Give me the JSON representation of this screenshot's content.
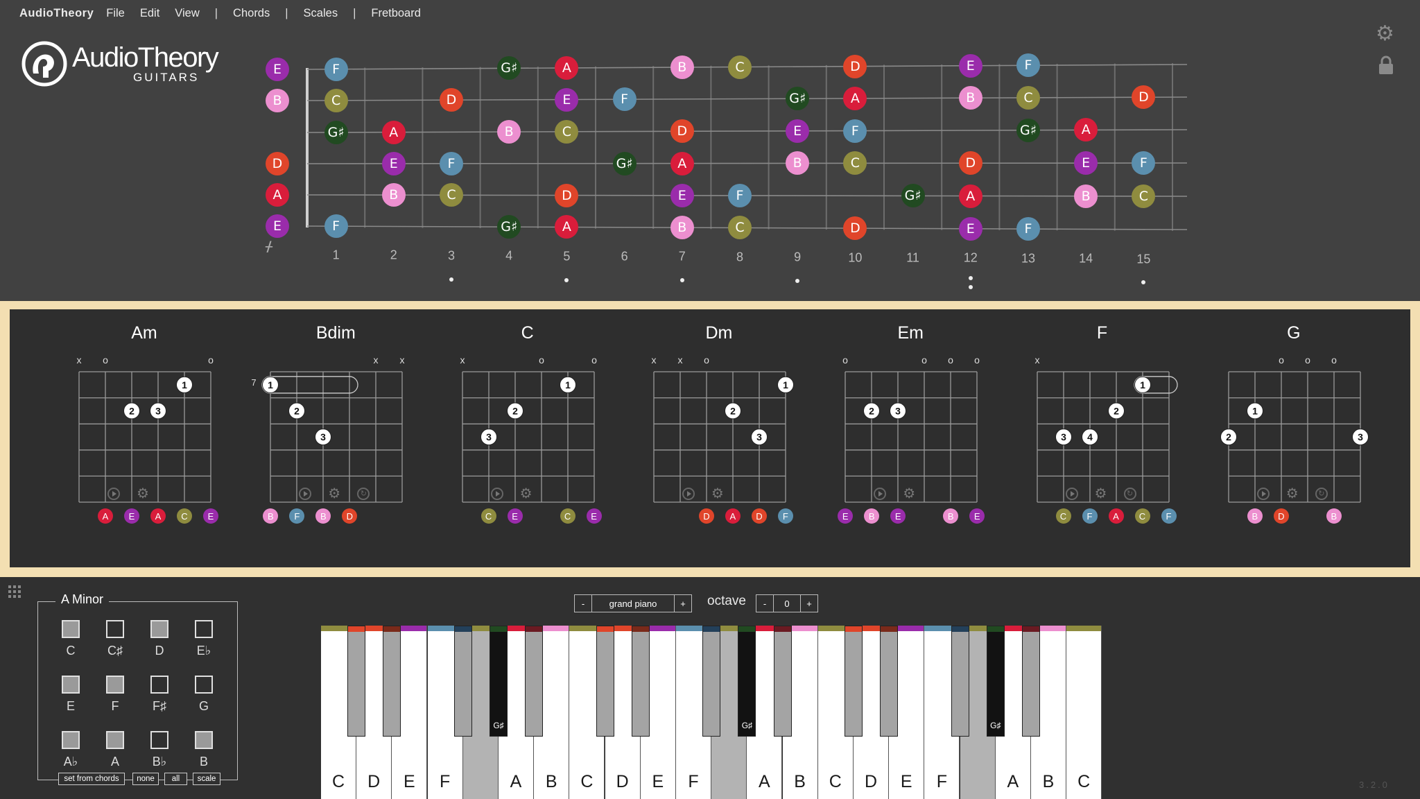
{
  "menubar": {
    "app_name": "AudioTheory",
    "items": [
      "File",
      "Edit",
      "View",
      "Chords",
      "Scales",
      "Fretboard"
    ],
    "separator": "|"
  },
  "logo": {
    "word": "AudioTheory",
    "sub": "GUITARS"
  },
  "icons": {
    "settings": "gear-icon",
    "lock": "lock-icon",
    "nut": "fork-icon",
    "grid": "grid-icon"
  },
  "note_colors": {
    "C": "#8f8c3f",
    "C#": "#1e3a1e",
    "D": "#e0452a",
    "D#": "#7a2a1a",
    "E": "#9a2cab",
    "F": "#5b8fae",
    "F#": "#23405a",
    "G": "#2f5b2f",
    "G#": "#214a21",
    "A": "#d91d3b",
    "A#": "#6a1a22",
    "B": "#ec8fcf"
  },
  "fretboard": {
    "open_notes": [
      "E",
      "B",
      "",
      "D",
      "A",
      "E"
    ],
    "fret_numbers": [
      "1",
      "2",
      "3",
      "4",
      "5",
      "6",
      "7",
      "8",
      "9",
      "10",
      "11",
      "12",
      "13",
      "14",
      "15"
    ],
    "inlay_frets": [
      3,
      5,
      7,
      9,
      15
    ],
    "double_inlay_fret": 12,
    "notes": [
      [
        "F",
        "",
        "",
        "G♯",
        "A",
        "",
        "B",
        "C",
        "",
        "D",
        "",
        "E",
        "F",
        "",
        ""
      ],
      [
        "C",
        "",
        "D",
        "",
        "E",
        "F",
        "",
        "",
        "G♯",
        "A",
        "",
        "B",
        "C",
        "",
        "D"
      ],
      [
        "G♯",
        "A",
        "",
        "B",
        "C",
        "",
        "D",
        "",
        "E",
        "F",
        "",
        "",
        "G♯",
        "A",
        ""
      ],
      [
        "",
        "E",
        "F",
        "",
        "",
        "G♯",
        "A",
        "",
        "B",
        "C",
        "",
        "D",
        "",
        "E",
        "F"
      ],
      [
        "",
        "B",
        "C",
        "",
        "D",
        "",
        "E",
        "F",
        "",
        "",
        "G♯",
        "A",
        "",
        "B",
        "C"
      ],
      [
        "F",
        "",
        "",
        "G♯",
        "A",
        "",
        "B",
        "C",
        "",
        "D",
        "",
        "E",
        "F",
        "",
        ""
      ]
    ]
  },
  "chords": [
    {
      "name": "Am",
      "markers": [
        "x",
        "o",
        "",
        "",
        "",
        "o"
      ],
      "fret_label": "",
      "dots": [
        {
          "s": 4,
          "f": 1,
          "n": "1"
        },
        {
          "s": 2,
          "f": 2,
          "n": "2"
        },
        {
          "s": 3,
          "f": 2,
          "n": "3"
        }
      ],
      "barre": null,
      "notes": [
        "",
        "A",
        "E",
        "A",
        "C",
        "E"
      ],
      "controls": [
        "play-icon",
        "gear-icon"
      ]
    },
    {
      "name": "Bdim",
      "markers": [
        "",
        "",
        "",
        "",
        "x",
        "x"
      ],
      "fret_label": "7",
      "dots": [
        {
          "s": 0,
          "f": 1,
          "n": "1"
        },
        {
          "s": 1,
          "f": 2,
          "n": "2"
        },
        {
          "s": 2,
          "f": 3,
          "n": "3"
        }
      ],
      "barre": {
        "from": 0,
        "to": 3,
        "f": 1
      },
      "notes": [
        "B",
        "F",
        "B",
        "D",
        "",
        ""
      ],
      "controls": [
        "play-icon",
        "gear-icon",
        "swap-icon"
      ]
    },
    {
      "name": "C",
      "markers": [
        "x",
        "",
        "",
        "o",
        "",
        "o"
      ],
      "fret_label": "",
      "dots": [
        {
          "s": 4,
          "f": 1,
          "n": "1"
        },
        {
          "s": 2,
          "f": 2,
          "n": "2"
        },
        {
          "s": 1,
          "f": 3,
          "n": "3"
        }
      ],
      "barre": null,
      "notes": [
        "",
        "C",
        "E",
        "",
        "C",
        "E"
      ],
      "controls": [
        "play-icon",
        "gear-icon"
      ]
    },
    {
      "name": "Dm",
      "markers": [
        "x",
        "x",
        "o",
        "",
        "",
        ""
      ],
      "fret_label": "",
      "dots": [
        {
          "s": 5,
          "f": 1,
          "n": "1"
        },
        {
          "s": 3,
          "f": 2,
          "n": "2"
        },
        {
          "s": 4,
          "f": 3,
          "n": "3"
        }
      ],
      "barre": null,
      "notes": [
        "",
        "",
        "D",
        "A",
        "D",
        "F"
      ],
      "controls": [
        "play-icon",
        "gear-icon"
      ]
    },
    {
      "name": "Em",
      "markers": [
        "o",
        "",
        "",
        "o",
        "o",
        "o"
      ],
      "fret_label": "",
      "dots": [
        {
          "s": 1,
          "f": 2,
          "n": "2"
        },
        {
          "s": 2,
          "f": 2,
          "n": "3"
        }
      ],
      "barre": null,
      "notes": [
        "E",
        "B",
        "E",
        "",
        "B",
        "E"
      ],
      "controls": [
        "play-icon",
        "gear-icon"
      ]
    },
    {
      "name": "F",
      "markers": [
        "x",
        "",
        "",
        "",
        "",
        ""
      ],
      "fret_label": "",
      "dots": [
        {
          "s": 4,
          "f": 1,
          "n": "1"
        },
        {
          "s": 3,
          "f": 2,
          "n": "2"
        },
        {
          "s": 1,
          "f": 3,
          "n": "3"
        },
        {
          "s": 2,
          "f": 3,
          "n": "4"
        }
      ],
      "barre": {
        "from": 4,
        "to": 5,
        "f": 1
      },
      "notes": [
        "",
        "C",
        "F",
        "A",
        "C",
        "F"
      ],
      "controls": [
        "play-icon",
        "gear-icon",
        "swap-icon"
      ]
    },
    {
      "name": "G",
      "markers": [
        "",
        "",
        "o",
        "o",
        "o",
        ""
      ],
      "fret_label": "",
      "dots": [
        {
          "s": 1,
          "f": 2,
          "n": "1"
        },
        {
          "s": 0,
          "f": 3,
          "n": "2"
        },
        {
          "s": 5,
          "f": 3,
          "n": "3"
        }
      ],
      "barre": null,
      "notes": [
        "",
        "B",
        "D",
        "",
        "B",
        ""
      ],
      "controls": [
        "play-icon",
        "gear-icon",
        "swap-icon"
      ]
    }
  ],
  "scale": {
    "title": "A Minor",
    "notes": [
      {
        "label": "C",
        "on": true
      },
      {
        "label": "C♯",
        "on": false
      },
      {
        "label": "D",
        "on": true
      },
      {
        "label": "E♭",
        "on": false
      },
      {
        "label": "E",
        "on": true
      },
      {
        "label": "F",
        "on": true
      },
      {
        "label": "F♯",
        "on": false
      },
      {
        "label": "G",
        "on": false
      },
      {
        "label": "A♭",
        "on": true
      },
      {
        "label": "A",
        "on": true
      },
      {
        "label": "B♭",
        "on": false
      },
      {
        "label": "B",
        "on": true
      }
    ],
    "buttons": [
      "set from chords",
      "none",
      "all",
      "scale"
    ]
  },
  "instrument": {
    "minus": "-",
    "plus": "+",
    "name": "grand piano"
  },
  "octave": {
    "label": "octave",
    "minus": "-",
    "value": "0",
    "plus": "+"
  },
  "piano": {
    "white_keys": [
      {
        "n": "C",
        "top": "C",
        "sh": false
      },
      {
        "n": "D",
        "top": "D",
        "sh": false
      },
      {
        "n": "E",
        "top": "E",
        "sh": false
      },
      {
        "n": "F",
        "top": "F",
        "sh": false
      },
      {
        "n": "",
        "top": "",
        "sh": true
      },
      {
        "n": "A",
        "top": "A",
        "sh": false
      },
      {
        "n": "B",
        "top": "B",
        "sh": false
      },
      {
        "n": "C",
        "top": "C",
        "sh": false
      },
      {
        "n": "D",
        "top": "D",
        "sh": false
      },
      {
        "n": "E",
        "top": "E",
        "sh": false
      },
      {
        "n": "F",
        "top": "F",
        "sh": false
      },
      {
        "n": "",
        "top": "",
        "sh": true
      },
      {
        "n": "A",
        "top": "A",
        "sh": false
      },
      {
        "n": "B",
        "top": "B",
        "sh": false
      },
      {
        "n": "C",
        "top": "C",
        "sh": false
      },
      {
        "n": "D",
        "top": "D",
        "sh": false
      },
      {
        "n": "E",
        "top": "E",
        "sh": false
      },
      {
        "n": "F",
        "top": "F",
        "sh": false
      },
      {
        "n": "",
        "top": "",
        "sh": true
      },
      {
        "n": "A",
        "top": "A",
        "sh": false
      },
      {
        "n": "B",
        "top": "B",
        "sh": false
      },
      {
        "n": "C",
        "top": "C",
        "sh": false
      }
    ],
    "black_keys": [
      {
        "after": 0,
        "n": "",
        "dark": false
      },
      {
        "after": 1,
        "n": "",
        "dark": false
      },
      {
        "after": 3,
        "n": "",
        "dark": false
      },
      {
        "after": 4,
        "n": "G♯",
        "dark": true
      },
      {
        "after": 5,
        "n": "",
        "dark": false
      },
      {
        "after": 7,
        "n": "",
        "dark": false
      },
      {
        "after": 8,
        "n": "",
        "dark": false
      },
      {
        "after": 10,
        "n": "",
        "dark": false
      },
      {
        "after": 11,
        "n": "G♯",
        "dark": true
      },
      {
        "after": 12,
        "n": "",
        "dark": false
      },
      {
        "after": 14,
        "n": "",
        "dark": false
      },
      {
        "after": 15,
        "n": "",
        "dark": false
      },
      {
        "after": 17,
        "n": "",
        "dark": false
      },
      {
        "after": 18,
        "n": "G♯",
        "dark": true
      },
      {
        "after": 19,
        "n": "",
        "dark": false
      }
    ],
    "black_top_colors": [
      "D",
      "D#",
      "F#",
      "G#",
      "A#",
      "D",
      "D#",
      "F#",
      "G#",
      "A#",
      "D",
      "D#",
      "F#",
      "G#",
      "A#"
    ]
  },
  "version": "3.2.0"
}
